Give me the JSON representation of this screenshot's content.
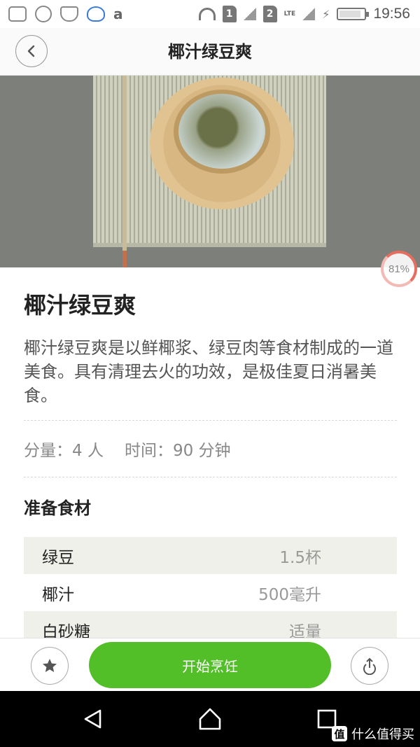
{
  "status_bar": {
    "icons": [
      "message-icon",
      "plus-circle-icon",
      "shield-icon",
      "chat-icon",
      "amazon-icon"
    ],
    "amazon_glyph": "a",
    "wifi_icon": "wifi-icon",
    "sim1": "1",
    "sim2": "2",
    "network": "LTE",
    "time": "19:56"
  },
  "header": {
    "title": "椰汁绿豆爽",
    "back_icon": "chevron-left-icon"
  },
  "hero": {
    "progress_label": "81%",
    "progress_value": 0.81
  },
  "recipe": {
    "title": "椰汁绿豆爽",
    "description": "椰汁绿豆爽是以鲜椰浆、绿豆肉等食材制成的一道美食。具有清理去火的功效，是极佳夏日消暑美食。",
    "servings_label": "分量：4 人",
    "time_label": "时间：90 分钟",
    "ingredients_title": "准备食材",
    "ingredients": [
      {
        "name": "绿豆",
        "qty": "1.5杯"
      },
      {
        "name": "椰汁",
        "qty": "500毫升"
      },
      {
        "name": "白砂糖",
        "qty": "适量"
      }
    ]
  },
  "actions": {
    "start_label": "开始烹饪",
    "favorite_icon": "star-icon",
    "share_icon": "share-icon"
  },
  "nav": {
    "back_icon": "nav-back-icon",
    "home_icon": "nav-home-icon",
    "recents_icon": "nav-recents-icon"
  },
  "watermark": {
    "badge": "值",
    "text": "什么值得买"
  },
  "colors": {
    "accent": "#52be28",
    "progress": "#e66e5f"
  }
}
